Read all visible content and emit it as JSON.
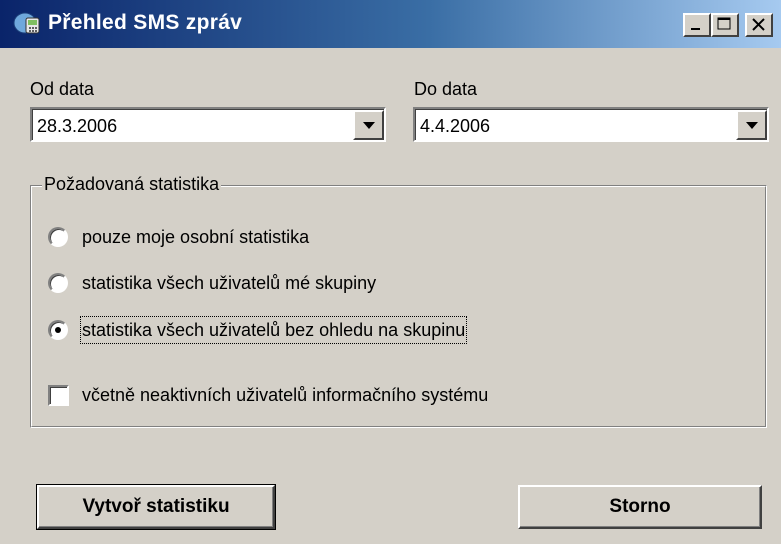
{
  "window": {
    "title": "Přehled SMS zpráv",
    "icon": "sms-app-icon",
    "caption_buttons": [
      "minimize",
      "maximize",
      "close"
    ]
  },
  "date_from": {
    "label": "Od data",
    "value": "28.3.2006"
  },
  "date_to": {
    "label": "Do data",
    "value": "4.4.2006"
  },
  "statistics_group": {
    "legend": "Požadovaná statistika",
    "options": [
      {
        "label": "pouze moje osobní statistika",
        "selected": false
      },
      {
        "label": "statistika všech uživatelů mé skupiny",
        "selected": false
      },
      {
        "label": "statistika všech uživatelů bez ohledu na skupinu",
        "selected": true
      }
    ],
    "include_inactive": {
      "label": "včetně neaktivních uživatelů informačního systému",
      "checked": false
    }
  },
  "buttons": {
    "create": "Vytvoř statistiku",
    "cancel": "Storno"
  },
  "colors": {
    "face": "#d4d0c8",
    "title_start": "#0a246a",
    "title_end": "#a6caf0"
  }
}
